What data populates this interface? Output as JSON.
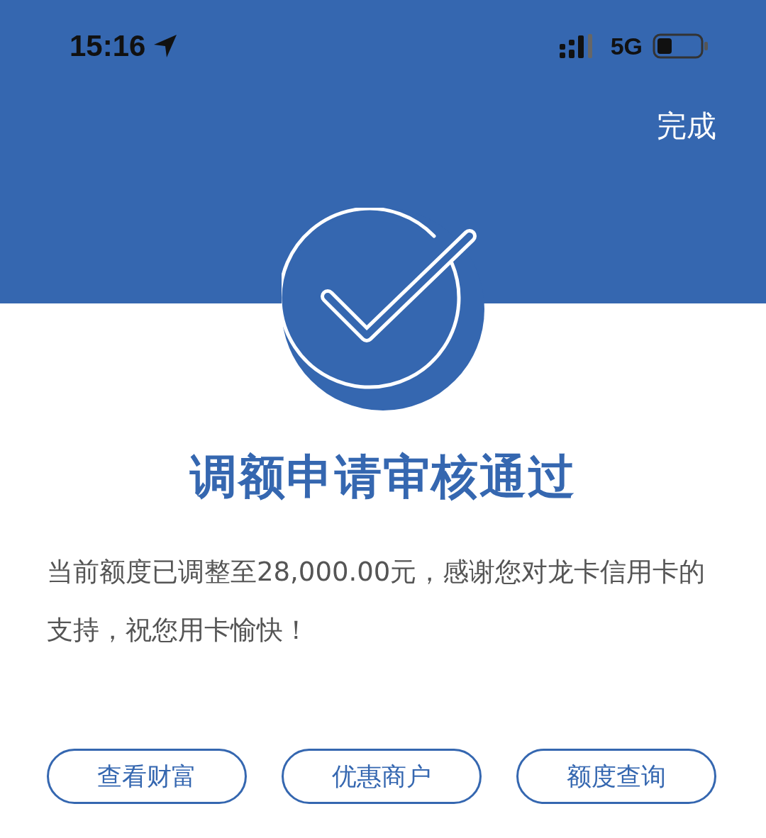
{
  "status_bar": {
    "time": "15:16",
    "network": "5G"
  },
  "header": {
    "done_button": "完成"
  },
  "result": {
    "title": "调额申请审核通过",
    "message": "当前额度已调整至28,000.00元，感谢您对龙卡信用卡的支持，祝您用卡愉快！"
  },
  "buttons": [
    "查看财富",
    "优惠商户",
    "额度查询"
  ]
}
